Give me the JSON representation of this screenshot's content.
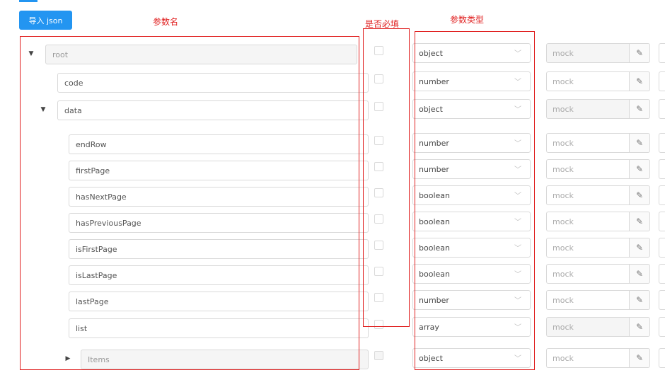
{
  "toolbar": {
    "import_label": "导入 json"
  },
  "annotations": {
    "name_label": "参数名",
    "required_label": "是否必填",
    "type_label": "参数类型"
  },
  "columns": {
    "mock_placeholder": "mock"
  },
  "rows": [
    {
      "name": "root",
      "type": "object",
      "level": 0,
      "caret": "expanded",
      "name_disabled": true,
      "required_disabled": false,
      "mock_disabled": true
    },
    {
      "name": "code",
      "type": "number",
      "level": 1,
      "caret": "none",
      "name_disabled": false,
      "required_disabled": false,
      "mock_disabled": false
    },
    {
      "name": "data",
      "type": "object",
      "level": 1,
      "caret": "expanded",
      "name_disabled": false,
      "required_disabled": false,
      "mock_disabled": true
    },
    {
      "name": "endRow",
      "type": "number",
      "level": 2,
      "caret": "none",
      "name_disabled": false,
      "required_disabled": false,
      "mock_disabled": false
    },
    {
      "name": "firstPage",
      "type": "number",
      "level": 2,
      "caret": "none",
      "name_disabled": false,
      "required_disabled": false,
      "mock_disabled": false
    },
    {
      "name": "hasNextPage",
      "type": "boolean",
      "level": 2,
      "caret": "none",
      "name_disabled": false,
      "required_disabled": false,
      "mock_disabled": false
    },
    {
      "name": "hasPreviousPage",
      "type": "boolean",
      "level": 2,
      "caret": "none",
      "name_disabled": false,
      "required_disabled": false,
      "mock_disabled": false
    },
    {
      "name": "isFirstPage",
      "type": "boolean",
      "level": 2,
      "caret": "none",
      "name_disabled": false,
      "required_disabled": false,
      "mock_disabled": false
    },
    {
      "name": "isLastPage",
      "type": "boolean",
      "level": 2,
      "caret": "none",
      "name_disabled": false,
      "required_disabled": false,
      "mock_disabled": false
    },
    {
      "name": "lastPage",
      "type": "number",
      "level": 2,
      "caret": "none",
      "name_disabled": false,
      "required_disabled": false,
      "mock_disabled": false
    },
    {
      "name": "list",
      "type": "array",
      "level": 2,
      "caret": "none",
      "name_disabled": false,
      "required_disabled": false,
      "mock_disabled": true
    },
    {
      "name": "Items",
      "type": "object",
      "level": 3,
      "caret": "collapsed",
      "name_disabled": true,
      "required_disabled": true,
      "mock_disabled": false
    }
  ],
  "colors": {
    "primary": "#2395f1",
    "annotation": "#e02020",
    "border": "#d9d9d9"
  }
}
